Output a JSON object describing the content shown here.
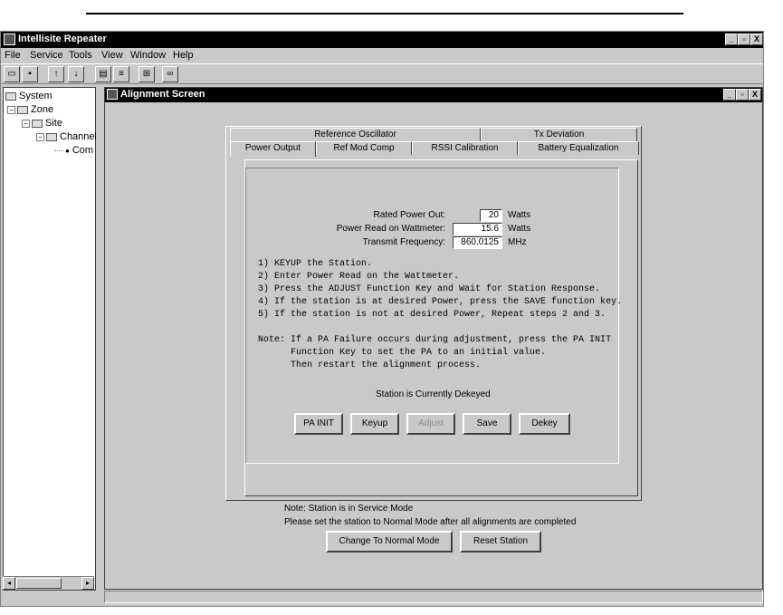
{
  "app": {
    "title": "Intellisite Repeater",
    "window_controls": [
      "_",
      "▫",
      "X"
    ]
  },
  "menubar": [
    {
      "label": "File"
    },
    {
      "label": "Service"
    },
    {
      "label": "Tools"
    },
    {
      "label": "View"
    },
    {
      "label": "Window"
    },
    {
      "label": "Help"
    }
  ],
  "toolbar": {
    "buttons": [
      "open-icon",
      "save-icon",
      "upload-icon",
      "download-icon",
      "print-icon",
      "list-icon",
      "network-icon",
      "binoculars-icon"
    ]
  },
  "tree": {
    "items": [
      {
        "label": "System"
      },
      {
        "label": "Zone"
      },
      {
        "label": "Site"
      },
      {
        "label": "Channel"
      },
      {
        "label": "Com"
      }
    ]
  },
  "child_window": {
    "title": "Alignment Screen"
  },
  "tabs": {
    "back_row": [
      "Reference Oscillator",
      "Tx Deviation"
    ],
    "front_row": [
      "Power Output",
      "Ref Mod Comp",
      "RSSI Calibration",
      "Battery Equalization"
    ],
    "active": "Power Output"
  },
  "power": {
    "rated_label": "Rated Power Out:",
    "rated_value": "20",
    "rated_unit": "Watts",
    "read_label": "Power Read on Wattmeter:",
    "read_value": "15.6",
    "read_unit": "Watts",
    "freq_label": "Transmit Frequency:",
    "freq_value": "860.0125",
    "freq_unit": "MHz"
  },
  "instructions": [
    "1) KEYUP the Station.",
    "2) Enter Power Read on the Wattmeter.",
    "3) Press the ADJUST Function Key and Wait for Station Response.",
    "4) If the station is at desired Power, press the SAVE function key.",
    "5) If the station is not at desired Power, Repeat steps 2 and 3."
  ],
  "note": [
    "Note: If a PA Failure occurs during adjustment, press the PA INIT",
    "      Function Key to set the PA to an initial value.",
    "      Then restart the alignment process."
  ],
  "station_status": "Station is Currently Dekeyed",
  "buttons": {
    "pa_init": "PA INIT",
    "keyup": "Keyup",
    "adjust": "Adjust",
    "save": "Save",
    "dekey": "Dekey"
  },
  "footer": {
    "note1": "Note: Station is in Service Mode",
    "note2": "Please set the station to Normal Mode after all alignments are completed",
    "change_mode": "Change To Normal Mode",
    "reset": "Reset Station"
  }
}
